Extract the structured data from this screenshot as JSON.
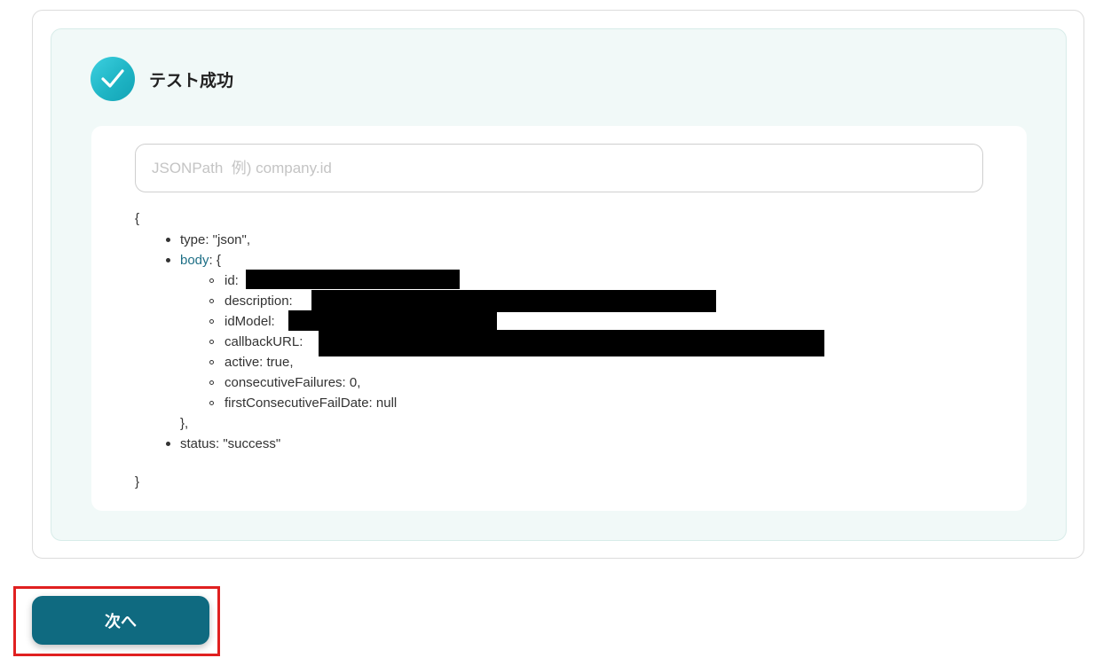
{
  "result": {
    "title": "テスト成功",
    "icon": "check-circle-icon",
    "accent_color": "#1fb5c5"
  },
  "jsonpath": {
    "placeholder": "JSONPath  例) company.id",
    "value": ""
  },
  "json_output": {
    "open_brace": "{",
    "type_line": "type: \"json\",",
    "body_key": "body",
    "body_open": ": {",
    "body_fields": {
      "id": "id:",
      "description": "description:",
      "idModel": "idModel:",
      "callbackURL": "callbackURL:",
      "active": "active: true,",
      "consecutiveFailures": "consecutiveFailures: 0,",
      "firstConsecutiveFailDate": "firstConsecutiveFailDate: null"
    },
    "body_close": "},",
    "status_line": "status: \"success\"",
    "close_brace": "}"
  },
  "actions": {
    "next_label": "次へ",
    "button_color": "#0f6a80",
    "highlight_color": "#e02020"
  }
}
